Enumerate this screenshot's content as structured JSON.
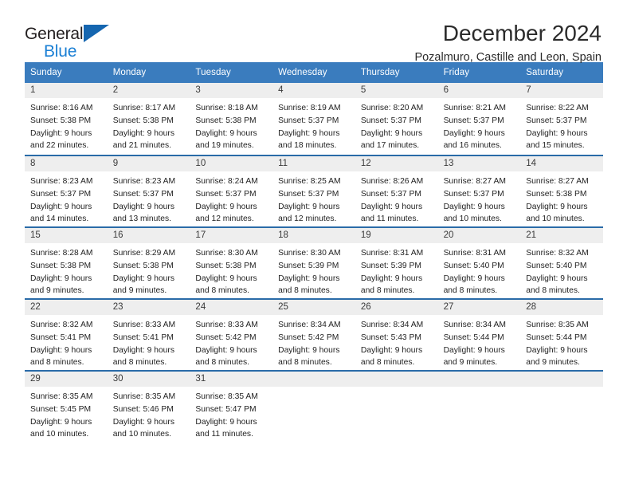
{
  "brand": {
    "name_part1": "General",
    "name_part2": "Blue",
    "accent_color": "#1566b0",
    "text_color": "#231f20"
  },
  "header": {
    "title": "December 2024",
    "subtitle": "Pozalmuro, Castille and Leon, Spain"
  },
  "calendar": {
    "header_bg": "#3a7cbe",
    "separator_color": "#2a6ba8",
    "day_band_bg": "#eeeeee",
    "weekdays": [
      "Sunday",
      "Monday",
      "Tuesday",
      "Wednesday",
      "Thursday",
      "Friday",
      "Saturday"
    ],
    "weeks": [
      [
        {
          "day": "1",
          "lines": [
            "Sunrise: 8:16 AM",
            "Sunset: 5:38 PM",
            "Daylight: 9 hours",
            "and 22 minutes."
          ]
        },
        {
          "day": "2",
          "lines": [
            "Sunrise: 8:17 AM",
            "Sunset: 5:38 PM",
            "Daylight: 9 hours",
            "and 21 minutes."
          ]
        },
        {
          "day": "3",
          "lines": [
            "Sunrise: 8:18 AM",
            "Sunset: 5:38 PM",
            "Daylight: 9 hours",
            "and 19 minutes."
          ]
        },
        {
          "day": "4",
          "lines": [
            "Sunrise: 8:19 AM",
            "Sunset: 5:37 PM",
            "Daylight: 9 hours",
            "and 18 minutes."
          ]
        },
        {
          "day": "5",
          "lines": [
            "Sunrise: 8:20 AM",
            "Sunset: 5:37 PM",
            "Daylight: 9 hours",
            "and 17 minutes."
          ]
        },
        {
          "day": "6",
          "lines": [
            "Sunrise: 8:21 AM",
            "Sunset: 5:37 PM",
            "Daylight: 9 hours",
            "and 16 minutes."
          ]
        },
        {
          "day": "7",
          "lines": [
            "Sunrise: 8:22 AM",
            "Sunset: 5:37 PM",
            "Daylight: 9 hours",
            "and 15 minutes."
          ]
        }
      ],
      [
        {
          "day": "8",
          "lines": [
            "Sunrise: 8:23 AM",
            "Sunset: 5:37 PM",
            "Daylight: 9 hours",
            "and 14 minutes."
          ]
        },
        {
          "day": "9",
          "lines": [
            "Sunrise: 8:23 AM",
            "Sunset: 5:37 PM",
            "Daylight: 9 hours",
            "and 13 minutes."
          ]
        },
        {
          "day": "10",
          "lines": [
            "Sunrise: 8:24 AM",
            "Sunset: 5:37 PM",
            "Daylight: 9 hours",
            "and 12 minutes."
          ]
        },
        {
          "day": "11",
          "lines": [
            "Sunrise: 8:25 AM",
            "Sunset: 5:37 PM",
            "Daylight: 9 hours",
            "and 12 minutes."
          ]
        },
        {
          "day": "12",
          "lines": [
            "Sunrise: 8:26 AM",
            "Sunset: 5:37 PM",
            "Daylight: 9 hours",
            "and 11 minutes."
          ]
        },
        {
          "day": "13",
          "lines": [
            "Sunrise: 8:27 AM",
            "Sunset: 5:37 PM",
            "Daylight: 9 hours",
            "and 10 minutes."
          ]
        },
        {
          "day": "14",
          "lines": [
            "Sunrise: 8:27 AM",
            "Sunset: 5:38 PM",
            "Daylight: 9 hours",
            "and 10 minutes."
          ]
        }
      ],
      [
        {
          "day": "15",
          "lines": [
            "Sunrise: 8:28 AM",
            "Sunset: 5:38 PM",
            "Daylight: 9 hours",
            "and 9 minutes."
          ]
        },
        {
          "day": "16",
          "lines": [
            "Sunrise: 8:29 AM",
            "Sunset: 5:38 PM",
            "Daylight: 9 hours",
            "and 9 minutes."
          ]
        },
        {
          "day": "17",
          "lines": [
            "Sunrise: 8:30 AM",
            "Sunset: 5:38 PM",
            "Daylight: 9 hours",
            "and 8 minutes."
          ]
        },
        {
          "day": "18",
          "lines": [
            "Sunrise: 8:30 AM",
            "Sunset: 5:39 PM",
            "Daylight: 9 hours",
            "and 8 minutes."
          ]
        },
        {
          "day": "19",
          "lines": [
            "Sunrise: 8:31 AM",
            "Sunset: 5:39 PM",
            "Daylight: 9 hours",
            "and 8 minutes."
          ]
        },
        {
          "day": "20",
          "lines": [
            "Sunrise: 8:31 AM",
            "Sunset: 5:40 PM",
            "Daylight: 9 hours",
            "and 8 minutes."
          ]
        },
        {
          "day": "21",
          "lines": [
            "Sunrise: 8:32 AM",
            "Sunset: 5:40 PM",
            "Daylight: 9 hours",
            "and 8 minutes."
          ]
        }
      ],
      [
        {
          "day": "22",
          "lines": [
            "Sunrise: 8:32 AM",
            "Sunset: 5:41 PM",
            "Daylight: 9 hours",
            "and 8 minutes."
          ]
        },
        {
          "day": "23",
          "lines": [
            "Sunrise: 8:33 AM",
            "Sunset: 5:41 PM",
            "Daylight: 9 hours",
            "and 8 minutes."
          ]
        },
        {
          "day": "24",
          "lines": [
            "Sunrise: 8:33 AM",
            "Sunset: 5:42 PM",
            "Daylight: 9 hours",
            "and 8 minutes."
          ]
        },
        {
          "day": "25",
          "lines": [
            "Sunrise: 8:34 AM",
            "Sunset: 5:42 PM",
            "Daylight: 9 hours",
            "and 8 minutes."
          ]
        },
        {
          "day": "26",
          "lines": [
            "Sunrise: 8:34 AM",
            "Sunset: 5:43 PM",
            "Daylight: 9 hours",
            "and 8 minutes."
          ]
        },
        {
          "day": "27",
          "lines": [
            "Sunrise: 8:34 AM",
            "Sunset: 5:44 PM",
            "Daylight: 9 hours",
            "and 9 minutes."
          ]
        },
        {
          "day": "28",
          "lines": [
            "Sunrise: 8:35 AM",
            "Sunset: 5:44 PM",
            "Daylight: 9 hours",
            "and 9 minutes."
          ]
        }
      ],
      [
        {
          "day": "29",
          "lines": [
            "Sunrise: 8:35 AM",
            "Sunset: 5:45 PM",
            "Daylight: 9 hours",
            "and 10 minutes."
          ]
        },
        {
          "day": "30",
          "lines": [
            "Sunrise: 8:35 AM",
            "Sunset: 5:46 PM",
            "Daylight: 9 hours",
            "and 10 minutes."
          ]
        },
        {
          "day": "31",
          "lines": [
            "Sunrise: 8:35 AM",
            "Sunset: 5:47 PM",
            "Daylight: 9 hours",
            "and 11 minutes."
          ]
        },
        {
          "day": "",
          "lines": []
        },
        {
          "day": "",
          "lines": []
        },
        {
          "day": "",
          "lines": []
        },
        {
          "day": "",
          "lines": []
        }
      ]
    ]
  }
}
